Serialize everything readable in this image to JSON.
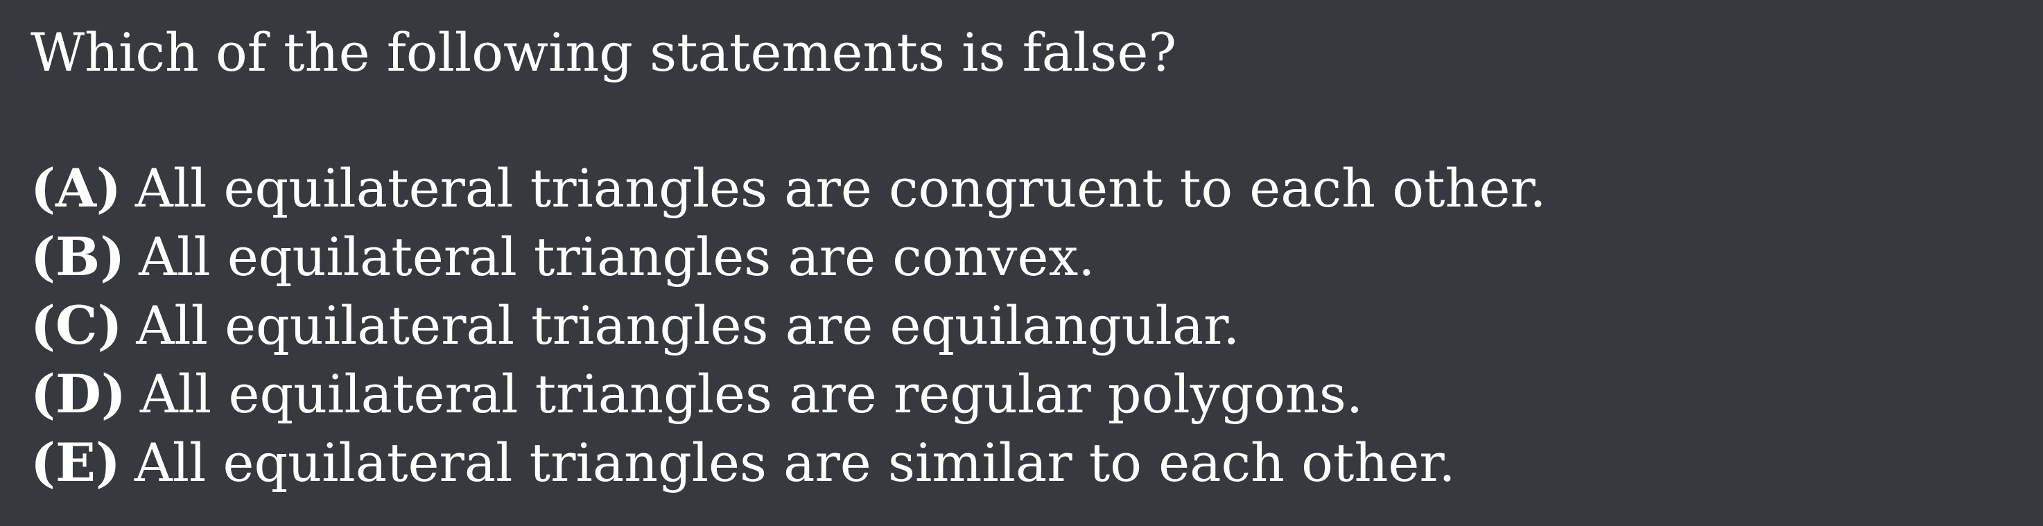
{
  "question": {
    "text": "Which of the following statements is false?"
  },
  "choices": [
    {
      "label": "(A)",
      "text": "All equilateral triangles are congruent to each other."
    },
    {
      "label": "(B)",
      "text": "All equilateral triangles are convex."
    },
    {
      "label": "(C)",
      "text": "All equilateral triangles are equilangular."
    },
    {
      "label": "(D)",
      "text": "All equilateral triangles are regular polygons."
    },
    {
      "label": "(E)",
      "text": "All equilateral triangles are similar to each other."
    }
  ],
  "colors": {
    "background": "#36393e",
    "text": "#ffffff"
  }
}
